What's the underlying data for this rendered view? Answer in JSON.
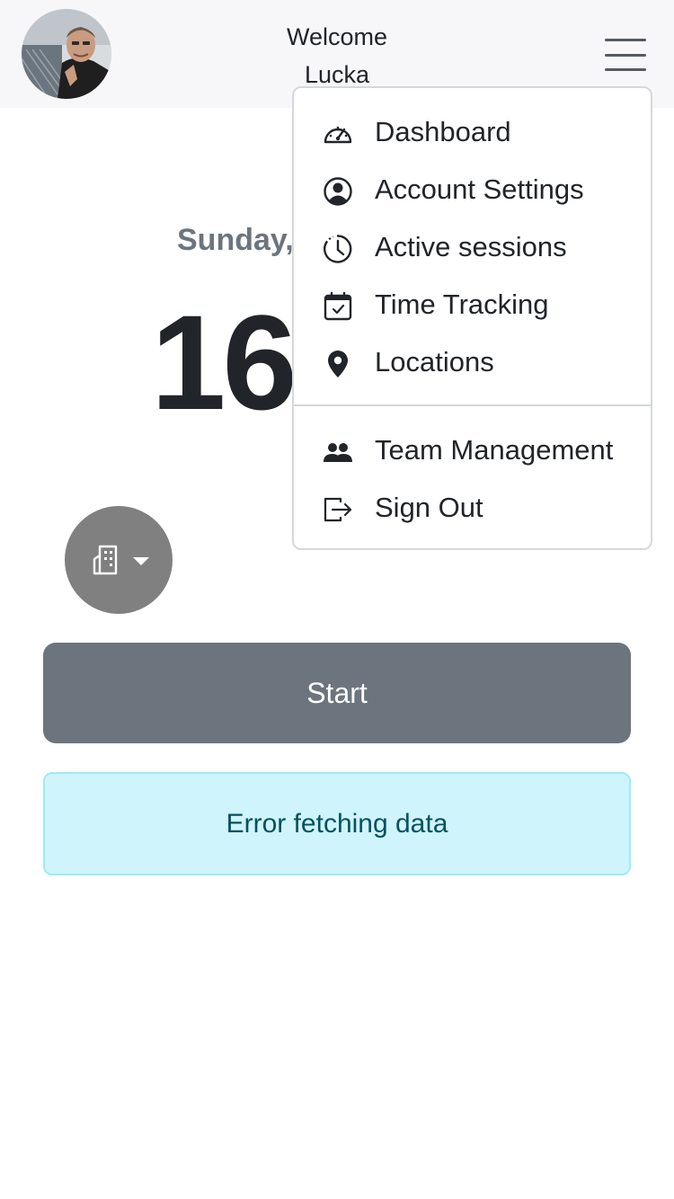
{
  "header": {
    "welcome_line1": "Welcome",
    "welcome_line2": "Lucka",
    "menu_icon": "hamburger-icon"
  },
  "main": {
    "date_text": "Sunday,",
    "time_text": "16",
    "location_icon": "building-icon",
    "start_label": "Start",
    "alert_text": "Error fetching data"
  },
  "menu": {
    "items": [
      {
        "label": "Dashboard",
        "icon": "speedometer-icon"
      },
      {
        "label": "Account Settings",
        "icon": "person-circle-icon"
      },
      {
        "label": "Active sessions",
        "icon": "clock-history-icon"
      },
      {
        "label": "Time Tracking",
        "icon": "calendar-check-icon"
      },
      {
        "label": "Locations",
        "icon": "geo-pin-icon"
      },
      {
        "label": "Team Management",
        "icon": "people-icon"
      },
      {
        "label": "Sign Out",
        "icon": "box-arrow-right-icon"
      }
    ]
  },
  "colors": {
    "header_bg": "#f7f7f9",
    "start_button": "#6c757d",
    "alert_bg": "#cff4fc",
    "alert_text": "#055160",
    "location_button": "#808080"
  }
}
